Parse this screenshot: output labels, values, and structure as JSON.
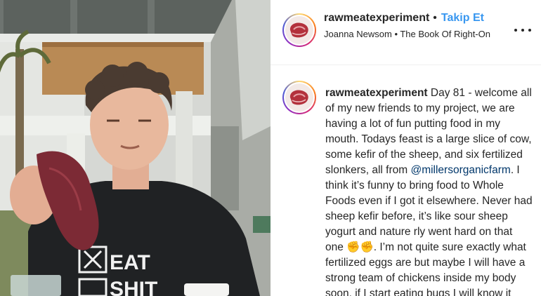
{
  "post": {
    "username": "rawmeatexperiment",
    "separator": "•",
    "follow_label": "Takip Et",
    "audio": "Joanna Newsom • The Book Of Right-On",
    "more_icon": "more-options-icon",
    "caption": {
      "username": "rawmeatexperiment",
      "text_1": "Day 81 - welcome all of my new friends to my project, we are having a lot of fun putting food in my mouth. Todays feast is a large slice of cow, some kefir of the sheep, and six fertilized slonkers, all from ",
      "mention": "@millersorganicfarm",
      "text_2": ". I think it’s funny to bring food to Whole Foods even if I got it elsewhere. Never had sheep kefir before, it’s like sour sheep yogurt and nature rly went hard on that one ✊✊. I’m not quite sure exactly what fertilized eggs are but maybe I will have a strong team of chickens inside my body soon, if I start eating bugs I will know it"
    }
  },
  "media": {
    "shirt_text_1": "EAT",
    "shirt_text_2": "SHIT"
  },
  "colors": {
    "follow": "#3897f0",
    "mention": "#00376b",
    "text": "#262626"
  }
}
